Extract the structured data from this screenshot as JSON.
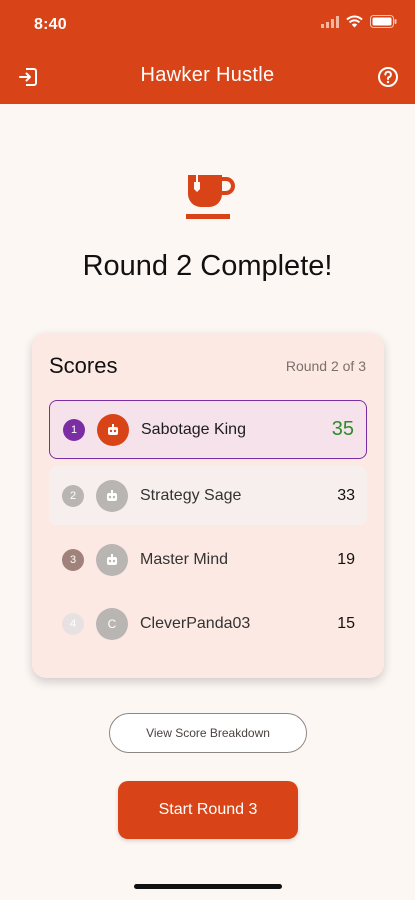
{
  "status_bar": {
    "time": "8:40"
  },
  "app_bar": {
    "title": "Hawker Hustle",
    "left_icon": "exit-icon",
    "right_icon": "help-icon"
  },
  "hero": {
    "icon": "cup-icon",
    "headline": "Round 2 Complete!"
  },
  "scores": {
    "title": "Scores",
    "round_label": "Round 2 of 3",
    "rows": [
      {
        "rank": "1",
        "name": "Sabotage King",
        "score": "35",
        "avatar": "robot-icon",
        "rank_color": "#7b2da3",
        "avatar_color": "#d84417"
      },
      {
        "rank": "2",
        "name": "Strategy Sage",
        "score": "33",
        "avatar": "robot-icon",
        "rank_color": "#b9b5b3",
        "avatar_color": "#b9b5b3"
      },
      {
        "rank": "3",
        "name": "Master Mind",
        "score": "19",
        "avatar": "robot-icon",
        "rank_color": "#a0827a",
        "avatar_color": "#b9b5b3"
      },
      {
        "rank": "4",
        "name": "CleverPanda03",
        "score": "15",
        "avatar_letter": "C",
        "rank_color": "#e7e2e1",
        "avatar_color": "#b9b5b3"
      }
    ]
  },
  "actions": {
    "breakdown_label": "View Score Breakdown",
    "start_label": "Start Round 3"
  },
  "colors": {
    "brand": "#d84417",
    "background": "#fdf7f4",
    "card": "#fde9e4",
    "leader": "#7b2da3",
    "leader_score": "#2e8b2e"
  }
}
